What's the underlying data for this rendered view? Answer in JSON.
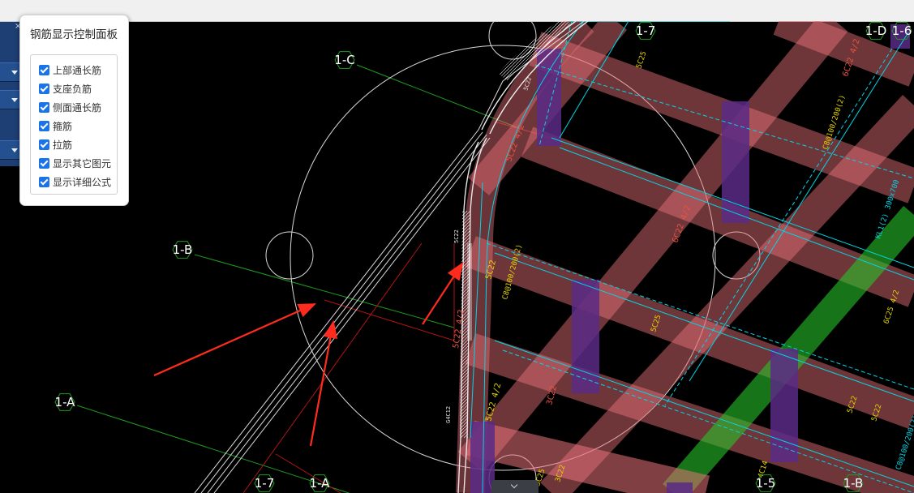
{
  "panel": {
    "title": "钢筋显示控制面板",
    "options": [
      {
        "label": "上部通长筋",
        "checked": true
      },
      {
        "label": "支座负筋",
        "checked": true
      },
      {
        "label": "侧面通长筋",
        "checked": true
      },
      {
        "label": "箍筋",
        "checked": true
      },
      {
        "label": "拉筋",
        "checked": true
      },
      {
        "label": "显示其它图元",
        "checked": true
      },
      {
        "label": "显示详细公式",
        "checked": true
      }
    ],
    "checkbox_color": "#1a73e8"
  },
  "axis_labels": {
    "top_1_7": "1-7",
    "left_1_c": "1-C",
    "left_1_b": "1-B",
    "left_1_a": "1-A",
    "bottom_1_7": "1-7",
    "bottom_1_a": "1-A",
    "top_1_d": "1-D",
    "top_1_6": "1-6",
    "bottom_1_5": "1-5",
    "bottom_1_b": "1-B"
  },
  "annotations": {
    "a1": "5C22 4/2",
    "a2": "6C22 4/2",
    "a3": "5C25",
    "a4": "C8@100/200(2)",
    "a5": "5C22",
    "a6": "C8@100/200(2)",
    "a7": "5C22 4/2",
    "a8": "6C22 4/2",
    "a9": "5C22",
    "a10": "G4C12",
    "a11": "5C22 4/2",
    "a12": "3C22",
    "a13": "5C25",
    "a14": "5C22",
    "a15": "KL1(2) 300x700",
    "a16": "6C25 4/2",
    "a17": "5C25",
    "a18": "4C14",
    "a19": "5C22",
    "a20": "C8@100/200(2)",
    "a21": "5C22",
    "a22": "3C22"
  },
  "colors": {
    "viewport_bg": "#000000",
    "beam": "#e8727a",
    "green_beam": "#29c229",
    "column": "#5b2a86",
    "rebar_cyan": "#00d6e6",
    "axis_green": "#1f9a1f",
    "axis_red": "#b01414",
    "text_yellow": "#e6d400",
    "text_red": "#e8543f",
    "arrow_red": "#ff2b1f"
  }
}
